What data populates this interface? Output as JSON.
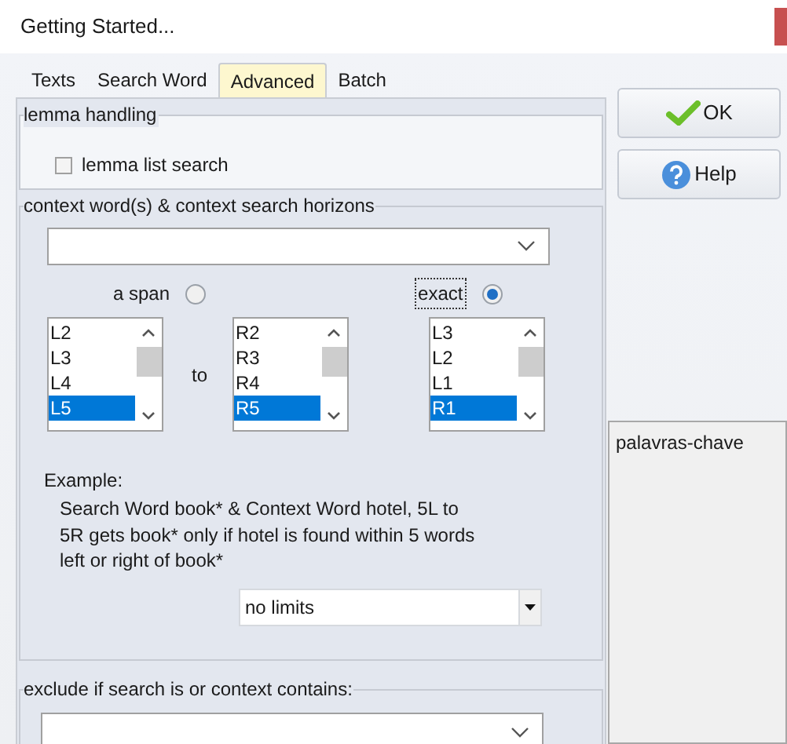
{
  "window": {
    "title": "Getting Started..."
  },
  "tabs": [
    {
      "label": "Texts",
      "selected": false
    },
    {
      "label": "Search Word",
      "selected": false
    },
    {
      "label": "Advanced",
      "selected": true
    },
    {
      "label": "Batch",
      "selected": false
    }
  ],
  "lemma_group": {
    "title": "lemma handling",
    "checkbox": {
      "label": "lemma list search",
      "checked": false
    }
  },
  "context_group": {
    "title": "context word(s) & context search horizons",
    "horizon_options": [
      {
        "label": "a span",
        "selected": false
      },
      {
        "label": "exact",
        "selected": true
      }
    ],
    "to_label": "to",
    "lists": [
      {
        "items": [
          {
            "text": "L2",
            "selected": false
          },
          {
            "text": "L3",
            "selected": false
          },
          {
            "text": "L4",
            "selected": false
          },
          {
            "text": "L5",
            "selected": true
          }
        ]
      },
      {
        "items": [
          {
            "text": "R2",
            "selected": false
          },
          {
            "text": "R3",
            "selected": false
          },
          {
            "text": "R4",
            "selected": false
          },
          {
            "text": "R5",
            "selected": true
          }
        ]
      },
      {
        "items": [
          {
            "text": "L3",
            "selected": false
          },
          {
            "text": "L2",
            "selected": false
          },
          {
            "text": "L1",
            "selected": false
          },
          {
            "text": "R1",
            "selected": true
          }
        ]
      }
    ],
    "example_title": "Example:",
    "example_text": "Search Word book* & Context Word hotel, 5L to 5R gets book* only if hotel is found within 5 words left or right of book*",
    "limit_dropdown": {
      "value": "no limits"
    }
  },
  "exclude_group": {
    "title": "exclude if search is or context contains:"
  },
  "buttons": [
    {
      "label": "OK",
      "kind": "ok"
    },
    {
      "label": "Help",
      "kind": "help"
    }
  ],
  "side_list": {
    "items": [
      "palavras-chave"
    ]
  }
}
